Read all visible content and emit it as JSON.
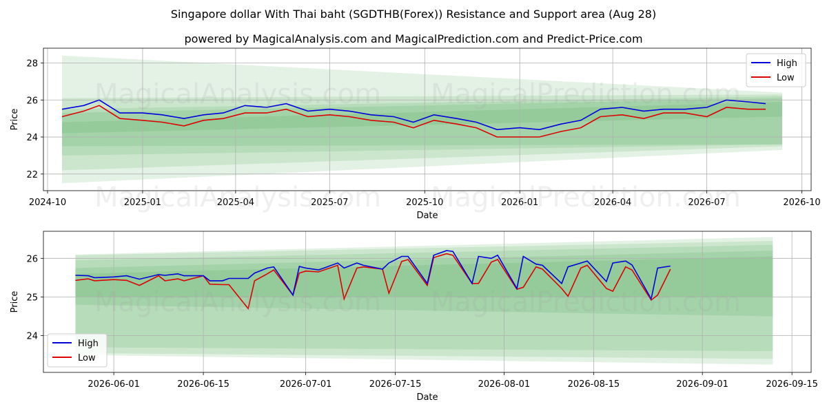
{
  "title": "Singapore dollar With Thai baht (SGDTHB(Forex)) Resistance and Support area (Aug 28)",
  "subtitle": "powered by MagicalAnalysis.com and MagicalPrediction.com and Predict-Price.com",
  "watermarks": [
    "MagicalAnalysis.com",
    "MagicalPrediction.com"
  ],
  "colors": {
    "high": "#0000dd",
    "low": "#dd0000",
    "band": "#2e9a36",
    "grid": "#b0b0b0"
  },
  "chart_data": [
    {
      "type": "line",
      "xlabel": "Date",
      "ylabel": "Price",
      "xlim": [
        "2024-09-27",
        "2026-10-10"
      ],
      "ylim": [
        21.1,
        28.8
      ],
      "x_ticks": [
        "2024-10",
        "2025-01",
        "2025-04",
        "2025-07",
        "2025-10",
        "2026-01",
        "2026-04",
        "2026-07",
        "2026-10"
      ],
      "y_ticks": [
        22,
        24,
        26,
        28
      ],
      "grid": true,
      "legend": "top-right",
      "legend_entries": [
        "High",
        "Low"
      ],
      "series": [
        {
          "name": "High",
          "x": [
            "2024-10-15",
            "2024-11-05",
            "2024-11-20",
            "2024-12-10",
            "2025-01-01",
            "2025-01-20",
            "2025-02-10",
            "2025-03-01",
            "2025-03-20",
            "2025-04-10",
            "2025-05-01",
            "2025-05-20",
            "2025-06-10",
            "2025-07-01",
            "2025-07-20",
            "2025-08-10",
            "2025-09-01",
            "2025-09-20",
            "2025-10-10",
            "2025-11-01",
            "2025-11-20",
            "2025-12-10",
            "2026-01-01",
            "2026-01-20",
            "2026-02-10",
            "2026-03-01",
            "2026-03-20",
            "2026-04-10",
            "2026-05-01",
            "2026-05-20",
            "2026-06-10",
            "2026-07-01",
            "2026-07-20",
            "2026-08-10",
            "2026-08-27"
          ],
          "values": [
            25.5,
            25.7,
            26.0,
            25.3,
            25.3,
            25.2,
            25.0,
            25.2,
            25.3,
            25.7,
            25.6,
            25.8,
            25.4,
            25.5,
            25.4,
            25.2,
            25.1,
            24.8,
            25.2,
            25.0,
            24.8,
            24.4,
            24.5,
            24.4,
            24.7,
            24.9,
            25.5,
            25.6,
            25.4,
            25.5,
            25.5,
            25.6,
            26.0,
            25.9,
            25.8
          ]
        },
        {
          "name": "Low",
          "x": [
            "2024-10-15",
            "2024-11-05",
            "2024-11-20",
            "2024-12-10",
            "2025-01-01",
            "2025-01-20",
            "2025-02-10",
            "2025-03-01",
            "2025-03-20",
            "2025-04-10",
            "2025-05-01",
            "2025-05-20",
            "2025-06-10",
            "2025-07-01",
            "2025-07-20",
            "2025-08-10",
            "2025-09-01",
            "2025-09-20",
            "2025-10-10",
            "2025-11-01",
            "2025-11-20",
            "2025-12-10",
            "2026-01-01",
            "2026-01-20",
            "2026-02-10",
            "2026-03-01",
            "2026-03-20",
            "2026-04-10",
            "2026-05-01",
            "2026-05-20",
            "2026-06-10",
            "2026-07-01",
            "2026-07-20",
            "2026-08-10",
            "2026-08-27"
          ],
          "values": [
            25.1,
            25.4,
            25.7,
            25.0,
            24.9,
            24.8,
            24.6,
            24.9,
            25.0,
            25.3,
            25.3,
            25.5,
            25.1,
            25.2,
            25.1,
            24.9,
            24.8,
            24.5,
            24.9,
            24.7,
            24.5,
            24.0,
            24.0,
            24.0,
            24.3,
            24.5,
            25.1,
            25.2,
            25.0,
            25.3,
            25.3,
            25.1,
            25.6,
            25.5,
            25.5
          ]
        }
      ],
      "bands": [
        {
          "x": [
            "2024-10-15",
            "2026-09-12"
          ],
          "upper": [
            28.4,
            26.4
          ],
          "lower": [
            21.5,
            23.3
          ]
        },
        {
          "x": [
            "2024-10-15",
            "2026-09-12"
          ],
          "upper": [
            26.1,
            26.3
          ],
          "lower": [
            22.2,
            23.5
          ]
        },
        {
          "x": [
            "2024-10-15",
            "2026-09-12"
          ],
          "upper": [
            25.5,
            26.2
          ],
          "lower": [
            23.0,
            23.6
          ]
        },
        {
          "x": [
            "2024-10-15",
            "2026-09-12"
          ],
          "upper": [
            25.3,
            26.1
          ],
          "lower": [
            23.5,
            23.6
          ]
        },
        {
          "x": [
            "2024-10-15",
            "2026-09-12"
          ],
          "upper": [
            24.8,
            25.9
          ],
          "lower": [
            24.2,
            25.1
          ]
        }
      ]
    },
    {
      "type": "line",
      "xlabel": "Date",
      "ylabel": "Price",
      "xlim": [
        "2026-05-21",
        "2026-09-18"
      ],
      "ylim": [
        23.05,
        26.7
      ],
      "x_ticks": [
        "2026-06-01",
        "2026-06-15",
        "2026-07-01",
        "2026-07-15",
        "2026-08-01",
        "2026-08-15",
        "2026-09-01",
        "2026-09-15"
      ],
      "y_ticks": [
        24,
        25,
        26
      ],
      "grid": true,
      "legend": "bottom-left",
      "legend_entries": [
        "High",
        "Low"
      ],
      "series": [
        {
          "name": "High",
          "x": [
            "2026-05-26",
            "2026-05-28",
            "2026-05-29",
            "2026-06-01",
            "2026-06-03",
            "2026-06-05",
            "2026-06-08",
            "2026-06-09",
            "2026-06-11",
            "2026-06-12",
            "2026-06-15",
            "2026-06-16",
            "2026-06-18",
            "2026-06-19",
            "2026-06-22",
            "2026-06-23",
            "2026-06-25",
            "2026-06-26",
            "2026-06-29",
            "2026-06-30",
            "2026-07-01",
            "2026-07-03",
            "2026-07-06",
            "2026-07-07",
            "2026-07-09",
            "2026-07-10",
            "2026-07-13",
            "2026-07-14",
            "2026-07-16",
            "2026-07-17",
            "2026-07-20",
            "2026-07-21",
            "2026-07-23",
            "2026-07-24",
            "2026-07-27",
            "2026-07-28",
            "2026-07-30",
            "2026-07-31",
            "2026-08-03",
            "2026-08-04",
            "2026-08-06",
            "2026-08-07",
            "2026-08-10",
            "2026-08-11",
            "2026-08-13",
            "2026-08-14",
            "2026-08-17",
            "2026-08-18",
            "2026-08-20",
            "2026-08-21",
            "2026-08-24",
            "2026-08-25",
            "2026-08-27"
          ],
          "values": [
            25.56,
            25.55,
            25.5,
            25.52,
            25.55,
            25.46,
            25.58,
            25.56,
            25.6,
            25.55,
            25.55,
            25.42,
            25.42,
            25.48,
            25.48,
            25.62,
            25.75,
            25.78,
            25.05,
            25.79,
            25.75,
            25.7,
            25.88,
            25.75,
            25.88,
            25.82,
            25.72,
            25.88,
            26.05,
            26.05,
            25.35,
            26.08,
            26.2,
            26.18,
            25.35,
            26.05,
            26.0,
            26.08,
            25.22,
            26.05,
            25.85,
            25.82,
            25.35,
            25.78,
            25.88,
            25.93,
            25.4,
            25.88,
            25.93,
            25.83,
            24.95,
            25.75,
            25.8
          ]
        },
        {
          "name": "Low",
          "x": [
            "2026-05-26",
            "2026-05-28",
            "2026-05-29",
            "2026-06-01",
            "2026-06-03",
            "2026-06-05",
            "2026-06-08",
            "2026-06-09",
            "2026-06-11",
            "2026-06-12",
            "2026-06-15",
            "2026-06-16",
            "2026-06-18",
            "2026-06-19",
            "2026-06-22",
            "2026-06-23",
            "2026-06-25",
            "2026-06-26",
            "2026-06-29",
            "2026-06-30",
            "2026-07-01",
            "2026-07-03",
            "2026-07-06",
            "2026-07-07",
            "2026-07-09",
            "2026-07-10",
            "2026-07-13",
            "2026-07-14",
            "2026-07-16",
            "2026-07-17",
            "2026-07-20",
            "2026-07-21",
            "2026-07-23",
            "2026-07-24",
            "2026-07-27",
            "2026-07-28",
            "2026-07-30",
            "2026-07-31",
            "2026-08-03",
            "2026-08-04",
            "2026-08-06",
            "2026-08-07",
            "2026-08-10",
            "2026-08-11",
            "2026-08-13",
            "2026-08-14",
            "2026-08-17",
            "2026-08-18",
            "2026-08-20",
            "2026-08-21",
            "2026-08-24",
            "2026-08-25",
            "2026-08-27"
          ],
          "values": [
            25.43,
            25.47,
            25.42,
            25.45,
            25.43,
            25.3,
            25.55,
            25.42,
            25.47,
            25.42,
            25.55,
            25.33,
            25.32,
            25.32,
            24.7,
            25.42,
            25.6,
            25.7,
            25.05,
            25.62,
            25.67,
            25.65,
            25.82,
            24.95,
            25.75,
            25.78,
            25.72,
            25.1,
            25.92,
            25.97,
            25.3,
            26.02,
            26.12,
            26.08,
            25.35,
            25.35,
            25.9,
            25.97,
            25.2,
            25.25,
            25.78,
            25.72,
            25.22,
            25.02,
            25.75,
            25.82,
            25.22,
            25.15,
            25.78,
            25.7,
            24.92,
            25.05,
            25.72
          ]
        }
      ],
      "bands": [
        {
          "x": [
            "2026-05-26",
            "2026-09-12"
          ],
          "upper": [
            26.1,
            26.55
          ],
          "lower": [
            23.5,
            23.25
          ]
        },
        {
          "x": [
            "2026-05-26",
            "2026-09-12"
          ],
          "upper": [
            26.08,
            26.45
          ],
          "lower": [
            23.55,
            23.4
          ]
        },
        {
          "x": [
            "2026-05-26",
            "2026-09-12"
          ],
          "upper": [
            25.95,
            26.35
          ],
          "lower": [
            23.7,
            23.6
          ]
        },
        {
          "x": [
            "2026-05-26",
            "2026-09-12"
          ],
          "upper": [
            25.75,
            26.2
          ],
          "lower": [
            24.8,
            24.5
          ]
        },
        {
          "x": [
            "2026-05-26",
            "2026-09-12"
          ],
          "upper": [
            25.6,
            26.05
          ],
          "lower": [
            25.0,
            25.0
          ]
        }
      ]
    }
  ]
}
